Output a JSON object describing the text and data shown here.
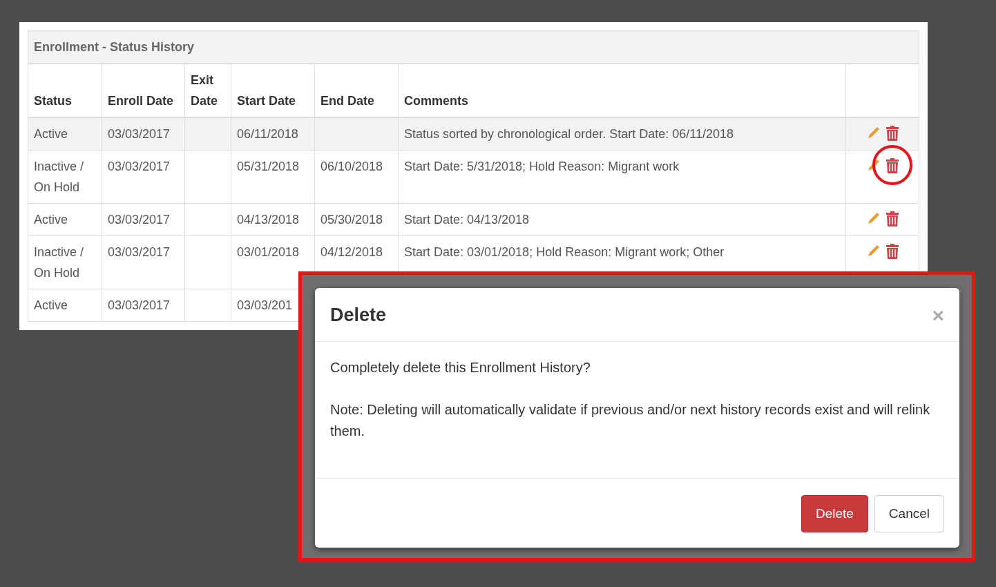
{
  "panel": {
    "title": "Enrollment - Status History"
  },
  "table": {
    "columns": [
      {
        "label": "Status"
      },
      {
        "label": "Enroll Date"
      },
      {
        "label": "Exit Date"
      },
      {
        "label": "Start Date"
      },
      {
        "label": "End Date"
      },
      {
        "label": "Comments"
      }
    ],
    "rows": [
      {
        "status": "Active",
        "enroll_date": "03/03/2017",
        "exit_date": "",
        "start_date": "06/11/2018",
        "end_date": "",
        "comments": "Status sorted by chronological order. Start Date: 06/11/2018",
        "highlighted": true,
        "actions": true,
        "circled": false
      },
      {
        "status": "Inactive / On Hold",
        "enroll_date": "03/03/2017",
        "exit_date": "",
        "start_date": "05/31/2018",
        "end_date": "06/10/2018",
        "comments": "Start Date: 5/31/2018; Hold Reason: Migrant work",
        "highlighted": false,
        "actions": true,
        "circled": true
      },
      {
        "status": "Active",
        "enroll_date": "03/03/2017",
        "exit_date": "",
        "start_date": "04/13/2018",
        "end_date": "05/30/2018",
        "comments": "Start Date: 04/13/2018",
        "highlighted": false,
        "actions": true,
        "circled": false
      },
      {
        "status": "Inactive / On Hold",
        "enroll_date": "03/03/2017",
        "exit_date": "",
        "start_date": "03/01/2018",
        "end_date": "04/12/2018",
        "comments": "Start Date: 03/01/2018; Hold Reason: Migrant work; Other",
        "highlighted": false,
        "actions": true,
        "circled": false
      },
      {
        "status": "Active",
        "enroll_date": "03/03/2017",
        "exit_date": "",
        "start_date": "03/03/201",
        "end_date": "",
        "comments": "",
        "highlighted": false
      }
    ]
  },
  "modal": {
    "title": "Delete",
    "close": "×",
    "messages": [
      "Completely delete this Enrollment History?",
      "Note: Deleting will automatically validate if previous and/or next history records exist and will relink them."
    ],
    "buttons": [
      {
        "label": "Delete",
        "kind": "danger"
      },
      {
        "label": "Cancel",
        "kind": "default"
      }
    ]
  }
}
